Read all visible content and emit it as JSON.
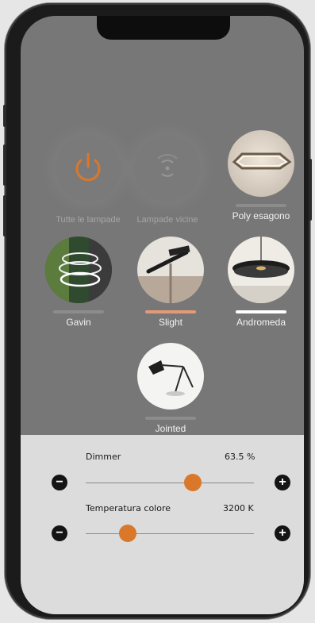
{
  "colors": {
    "accent": "#d9782a",
    "screen_bg": "#777777",
    "panel_bg": "#dcdcdc"
  },
  "tiles": [
    {
      "label": "Tutte le lampade",
      "icon": "power-icon",
      "selected": false
    },
    {
      "label": "Lampade vicine",
      "icon": "proximity-icon",
      "selected": false
    },
    {
      "label": "Poly esagono",
      "icon": "poly-esagono-lamp-image",
      "selected": false
    },
    {
      "label": "Gavin",
      "icon": "gavin-lamp-image",
      "selected": false
    },
    {
      "label": "Slight",
      "icon": "slight-lamp-image",
      "selected": true
    },
    {
      "label": "Andromeda",
      "icon": "andromeda-lamp-image",
      "selected": true
    },
    {
      "label": "Jointed",
      "icon": "jointed-lamp-image",
      "selected": false
    }
  ],
  "controls": {
    "dimmer": {
      "label": "Dimmer",
      "value": "63.5 %",
      "level": 0.635
    },
    "temperature": {
      "label": "Temperatura colore",
      "value": "3200 K",
      "level": 0.25
    }
  }
}
